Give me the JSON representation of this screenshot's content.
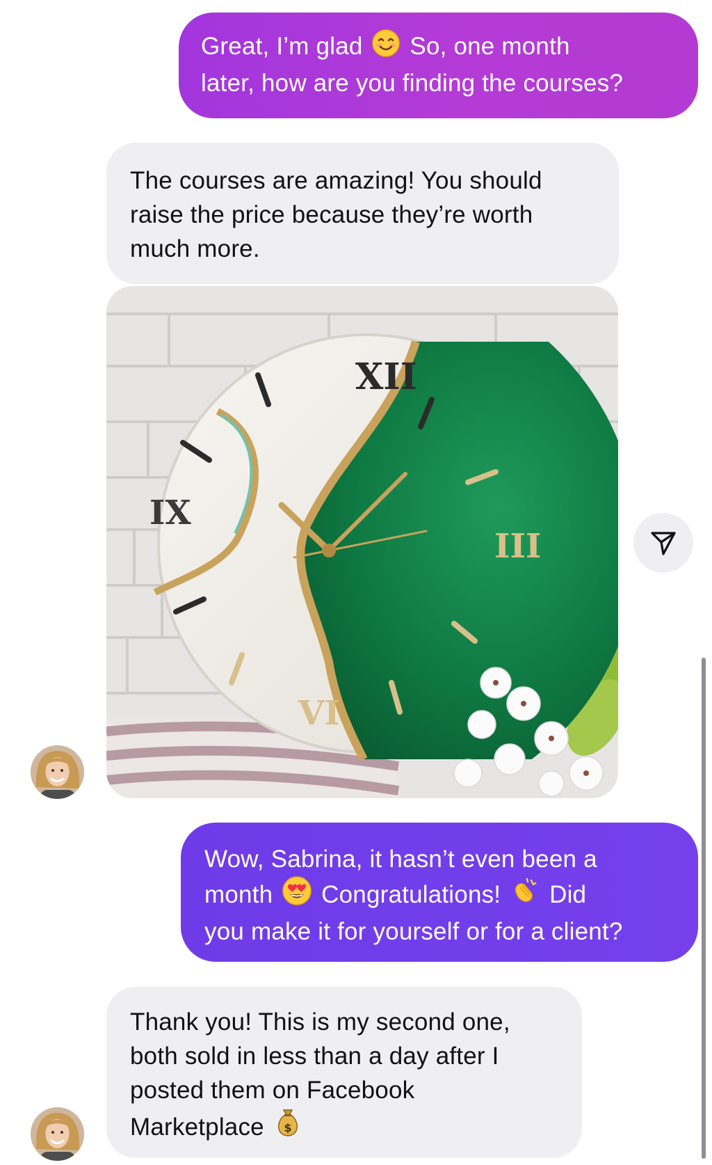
{
  "messages": [
    {
      "sender": "me",
      "line1_a": "Great, I’m glad",
      "emoji1": "smiling-face-emoji",
      "line1_b": "So, one month",
      "line2": "later, how are you finding the courses?"
    },
    {
      "sender": "other",
      "line1": "The courses are amazing! You should",
      "line2": "raise the price because they’re worth",
      "line3": "much more."
    },
    {
      "sender": "other",
      "type": "photo",
      "clock_numerals": [
        "XII",
        "III",
        "VI",
        "IX"
      ]
    },
    {
      "sender": "me",
      "line1": "Wow, Sabrina, it hasn’t even been a",
      "line2_a": "month",
      "emoji1": "heart-eyes-emoji",
      "line2_b": "Congratulations!",
      "emoji2": "clapping-hands-emoji",
      "line2_c": "Did",
      "line3": "you make it for yourself or for a client?"
    },
    {
      "sender": "other",
      "line1": "Thank you! This is my second one,",
      "line2": "both sold in less than a day after I",
      "line3": "posted them on Facebook",
      "line4": "Marketplace",
      "emoji1": "money-bag-emoji"
    }
  ],
  "colors": {
    "outgoing_purple": "#b03ad6",
    "outgoing_violet": "#7240ea",
    "incoming_gray": "#efeff1",
    "text_dark": "#111111"
  },
  "icons": {
    "share": "paper-plane-icon"
  }
}
